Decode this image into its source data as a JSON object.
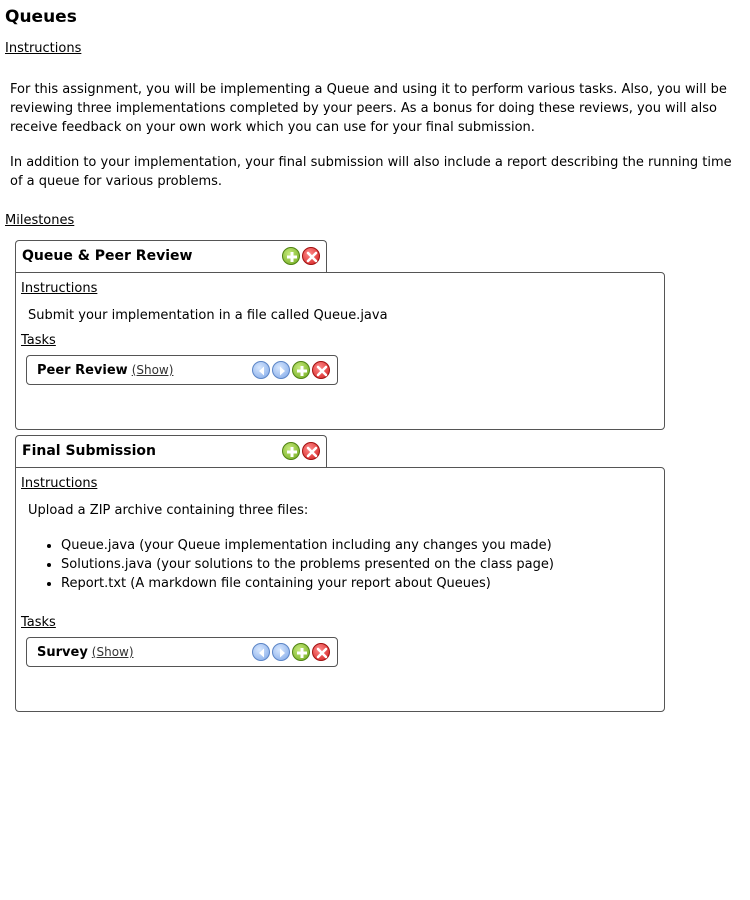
{
  "page": {
    "title": "Queues",
    "instructions_label": "Instructions",
    "instructions_p1": "For this assignment, you will be implementing a Queue and using it to perform various tasks. Also, you will be reviewing three implementations completed by your peers. As a bonus for doing these reviews, you will also receive feedback on your own work which you can use for your final submission.",
    "instructions_p2": "In addition to your implementation, your final submission will also include a report describing the running time of a queue for various problems.",
    "milestones_label": "Milestones"
  },
  "milestones": [
    {
      "title": "Queue & Peer Review",
      "instructions_label": "Instructions",
      "instructions_text": "Submit your implementation in a file called Queue.java",
      "tasks_label": "Tasks",
      "tasks": [
        {
          "name": "Peer Review",
          "show_label": "(Show)"
        }
      ]
    },
    {
      "title": "Final Submission",
      "instructions_label": "Instructions",
      "instructions_text": "Upload a ZIP archive containing three files:",
      "files": [
        "Queue.java (your Queue implementation including any changes you made)",
        "Solutions.java (your solutions to the problems presented on the class page)",
        "Report.txt (A markdown file containing your report about Queues)"
      ],
      "tasks_label": "Tasks",
      "tasks": [
        {
          "name": "Survey",
          "show_label": "(Show)"
        }
      ]
    }
  ],
  "icons": {
    "add": "add-icon",
    "delete": "delete-icon",
    "move_left": "arrow-left-icon",
    "move_right": "arrow-right-icon"
  },
  "colors": {
    "add": "#7cb82f",
    "delete": "#e02424",
    "nav": "#8fb4ee",
    "border": "#555555"
  }
}
